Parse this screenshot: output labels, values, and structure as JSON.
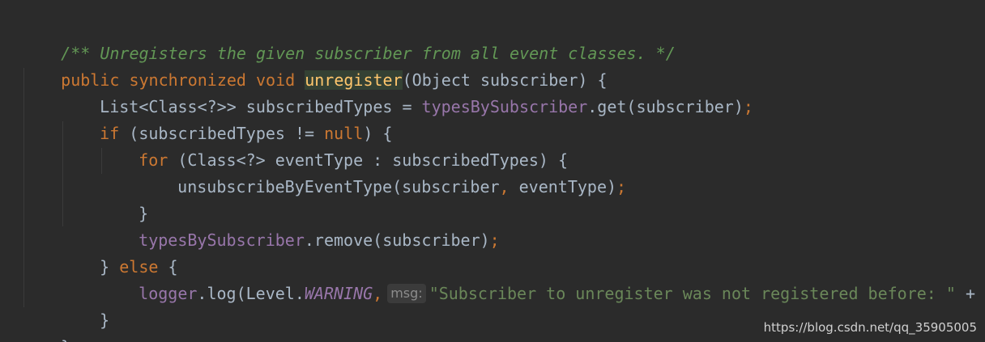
{
  "code": {
    "comment_line": "/** Unregisters the given subscriber from all event classes. */",
    "sig_kw": "public synchronized void",
    "sig_method": "unregister",
    "sig_rest": "(Object subscriber) {",
    "l3_a": "List<Class<?>> subscribedTypes = ",
    "l3_field": "typesBySubscriber",
    "l3_b": ".get(subscriber)",
    "l3_semi": ";",
    "l4_kw": "if",
    "l4_a": " (subscribedTypes != ",
    "l4_null": "null",
    "l4_b": ") {",
    "l5_kw": "for",
    "l5_a": " (Class<?> eventType : subscribedTypes) {",
    "l6_a": "unsubscribeByEventType(subscriber",
    "l6_comma": ",",
    "l6_b": " eventType)",
    "l6_semi": ";",
    "l7": "}",
    "l8_field": "typesBySubscriber",
    "l8_a": ".remove(subscriber)",
    "l8_semi": ";",
    "l9_a": "} ",
    "l9_kw": "else",
    "l9_b": " {",
    "l10_field": "logger",
    "l10_a": ".log(Level.",
    "l10_const": "WARNING",
    "l10_comma": ",",
    "l10_hint": "msg:",
    "l10_str": "\"Subscriber to unregister was not registered before: \"",
    "l10_b": " + sub",
    "l11": "}",
    "l12": "}"
  },
  "watermark": "https://blog.csdn.net/qq_35905005",
  "colors": {
    "background": "#2b2b2b",
    "keyword": "#cc7832",
    "comment": "#629755",
    "field": "#9876aa",
    "string": "#6a8759",
    "method_highlight": "#ffc66d",
    "default_text": "#a9b7c6"
  }
}
